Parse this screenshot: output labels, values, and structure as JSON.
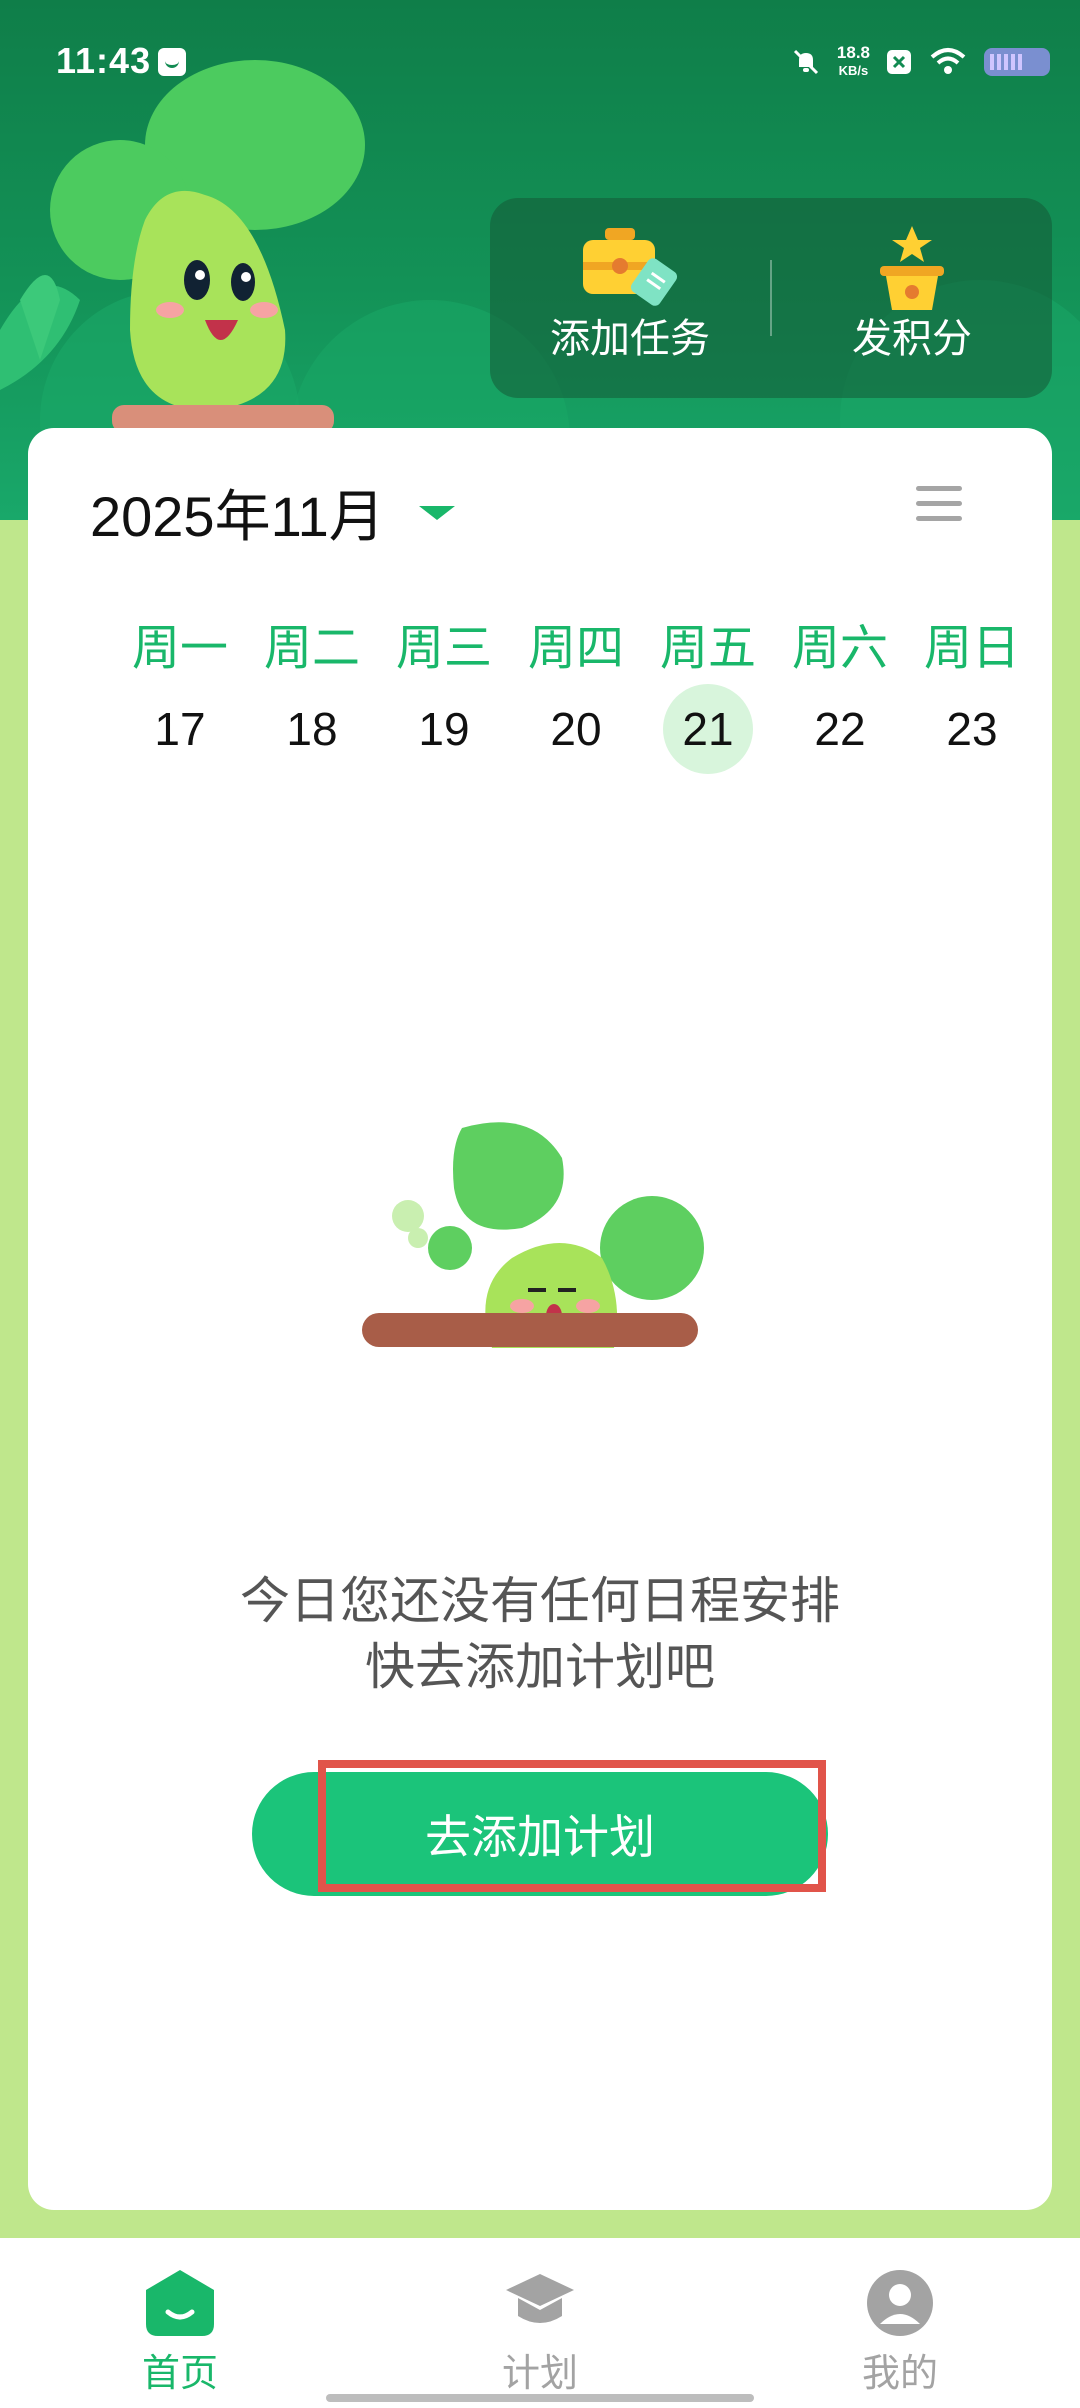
{
  "status_bar": {
    "time": "11:43",
    "net_speed_value": "18.8",
    "net_speed_unit": "KB/s",
    "icons": [
      "message-icon",
      "bell-off-icon",
      "x-icon",
      "wifi-icon",
      "battery-icon"
    ]
  },
  "header": {
    "actions": [
      {
        "label": "添加任务",
        "icon": "task-box-icon"
      },
      {
        "label": "发积分",
        "icon": "points-hat-icon"
      }
    ]
  },
  "calendar": {
    "month_label": "2025年11月",
    "weekdays": [
      "周一",
      "周二",
      "周三",
      "周四",
      "周五",
      "周六",
      "周日"
    ],
    "dates": [
      "17",
      "18",
      "19",
      "20",
      "21",
      "22",
      "23"
    ],
    "selected_date": "21"
  },
  "empty_state": {
    "line1": "今日您还没有任何日程安排",
    "line2": "快去添加计划吧",
    "button_label": "去添加计划"
  },
  "bottom_nav": {
    "items": [
      {
        "label": "首页",
        "icon": "home-icon",
        "active": true
      },
      {
        "label": "计划",
        "icon": "graduation-cap-icon",
        "active": false
      },
      {
        "label": "我的",
        "icon": "profile-icon",
        "active": false
      }
    ]
  },
  "colors": {
    "brand_green": "#19b76a",
    "header_green": "#128b52",
    "button_green": "#1bc47a",
    "highlight_red": "#e1544a"
  }
}
